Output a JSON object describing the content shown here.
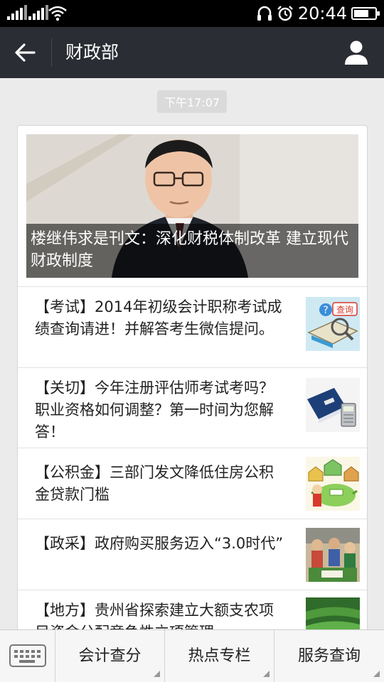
{
  "status_bar": {
    "time": "20:44"
  },
  "titlebar": {
    "title": "财政部"
  },
  "chat": {
    "timestamp": "下午17:07",
    "hero": {
      "caption": "楼继伟求是刊文：深化财税体制改革 建立现代财政制度"
    },
    "articles": [
      {
        "title": "【考试】2014年初级会计职称考试成绩查询请进！并解答考生微信提问。",
        "thumb_label": "查询"
      },
      {
        "title": "【关切】今年注册评估师考试考吗？职业资格如何调整？第一时间为您解答！"
      },
      {
        "title": "【公积金】三部门发文降低住房公积金贷款门槛"
      },
      {
        "title": "【政采】政府购买服务迈入“3.0时代”"
      },
      {
        "title": "【地方】贵州省探索建立大额支农项目资金分配竞争性立项管理"
      }
    ]
  },
  "bottom_menu": {
    "items": [
      {
        "label": "会计查分"
      },
      {
        "label": "热点专栏"
      },
      {
        "label": "服务查询"
      }
    ]
  },
  "colors": {
    "titlebar": "#2a2d33",
    "statusbar": "#000000",
    "background": "#ebebeb"
  }
}
